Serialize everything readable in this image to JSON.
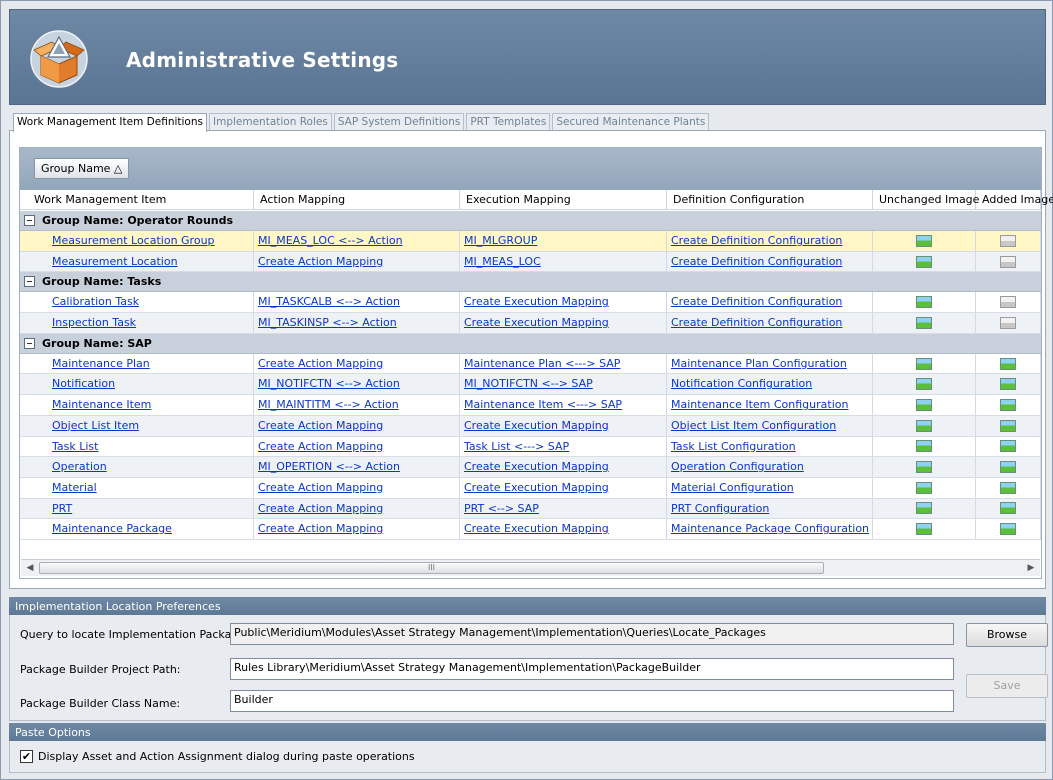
{
  "header": {
    "title": "Administrative Settings",
    "logo_icon": "box-triangle-logo-icon"
  },
  "tabs": [
    {
      "label": "Work Management Item Definitions",
      "active": true
    },
    {
      "label": "Implementation Roles",
      "active": false
    },
    {
      "label": "SAP System Definitions",
      "active": false
    },
    {
      "label": "PRT Templates",
      "active": false
    },
    {
      "label": "Secured Maintenance Plants",
      "active": false
    }
  ],
  "grid": {
    "group_chip": "Group Name △",
    "columns": [
      "Work Management Item",
      "Action Mapping",
      "Execution Mapping",
      "Definition Configuration",
      "Unchanged Image",
      "Added Image"
    ],
    "groups": [
      {
        "label": "Group Name: Operator Rounds",
        "rows": [
          {
            "item": "Measurement Location Group",
            "action": "MI_MEAS_LOC <--> Action",
            "execution": "MI_MLGROUP",
            "definition": "Create Definition Configuration",
            "unchanged": "green",
            "added": "grey"
          },
          {
            "item": "Measurement Location",
            "action": "Create Action Mapping",
            "execution": "MI_MEAS_LOC",
            "definition": "Create Definition Configuration",
            "unchanged": "green",
            "added": "grey"
          }
        ]
      },
      {
        "label": "Group Name: Tasks",
        "rows": [
          {
            "item": "Calibration Task",
            "action": "MI_TASKCALB <--> Action",
            "execution": "Create Execution Mapping",
            "definition": "Create Definition Configuration",
            "unchanged": "green",
            "added": "grey"
          },
          {
            "item": "Inspection Task",
            "action": "MI_TASKINSP <--> Action",
            "execution": "Create Execution Mapping",
            "definition": "Create Definition Configuration",
            "unchanged": "green",
            "added": "grey"
          }
        ]
      },
      {
        "label": "Group Name: SAP",
        "rows": [
          {
            "item": "Maintenance Plan",
            "action": "Create Action Mapping",
            "execution": "Maintenance Plan <---> SAP",
            "definition": "Maintenance Plan Configuration",
            "unchanged": "green",
            "added": "green"
          },
          {
            "item": "Notification",
            "action": "MI_NOTIFCTN <--> Action",
            "execution": "MI_NOTIFCTN <--> SAP",
            "definition": "Notification Configuration",
            "unchanged": "green",
            "added": "green"
          },
          {
            "item": "Maintenance Item",
            "action": "MI_MAINTITM <--> Action",
            "execution": "Maintenance Item <---> SAP",
            "definition": "Maintenance Item Configuration",
            "unchanged": "green",
            "added": "green"
          },
          {
            "item": "Object List Item",
            "action": "Create Action Mapping",
            "execution": "Create Execution Mapping",
            "definition": "Object List Item Configuration",
            "unchanged": "green",
            "added": "green"
          },
          {
            "item": "Task List",
            "action": "Create Action Mapping",
            "execution": "Task List <---> SAP",
            "definition": "Task List Configuration",
            "unchanged": "green",
            "added": "green"
          },
          {
            "item": "Operation",
            "action": "MI_OPERTION <--> Action",
            "execution": "Create Execution Mapping",
            "definition": "Operation Configuration",
            "unchanged": "green",
            "added": "green"
          },
          {
            "item": "Material",
            "action": "Create Action Mapping",
            "execution": "Create Execution Mapping",
            "definition": "Material Configuration",
            "unchanged": "green",
            "added": "green"
          },
          {
            "item": "PRT",
            "action": "Create Action Mapping",
            "execution": "PRT <--> SAP",
            "definition": "PRT Configuration",
            "unchanged": "green",
            "added": "green"
          },
          {
            "item": "Maintenance Package",
            "action": "Create Action Mapping",
            "execution": "Create Execution Mapping",
            "definition": "Maintenance Package Configuration",
            "unchanged": "green",
            "added": "green"
          }
        ]
      }
    ],
    "scroll_grip": "III"
  },
  "prefs": {
    "title": "Implementation Location Preferences",
    "query_label": "Query to locate Implementation Package:",
    "query_value": "Public\\Meridium\\Modules\\Asset Strategy Management\\Implementation\\Queries\\Locate_Packages",
    "path_label": "Package Builder Project Path:",
    "path_value": "Rules Library\\Meridium\\Asset Strategy Management\\Implementation\\PackageBuilder",
    "class_label": "Package Builder Class Name:",
    "class_value": "Builder",
    "browse_label": "Browse",
    "save_label": "Save"
  },
  "paste": {
    "title": "Paste Options",
    "checkbox_label": "Display Asset and Action Assignment dialog during paste operations",
    "checked": true
  }
}
